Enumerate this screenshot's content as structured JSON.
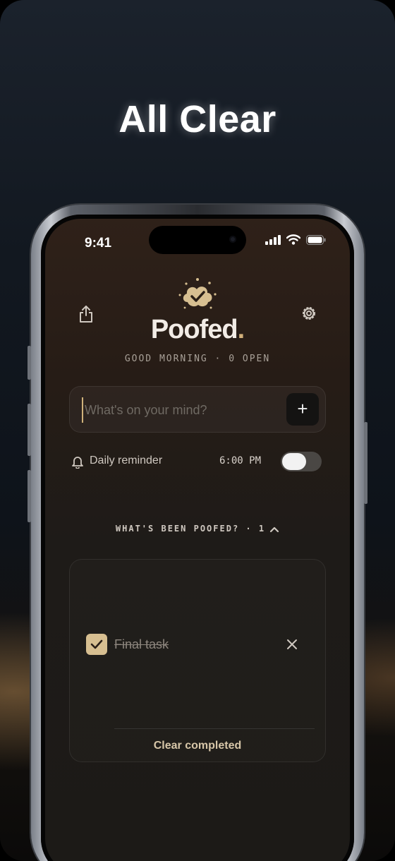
{
  "headline": "All Clear",
  "status_bar": {
    "time": "9:41"
  },
  "app": {
    "brand_name": "Poofed",
    "brand_dot": ".",
    "greeting": "GOOD MORNING · 0 OPEN",
    "input": {
      "value": "",
      "placeholder": "What's on your mind?"
    },
    "add_button_label": "+",
    "reminder": {
      "label": "Daily reminder",
      "time": "6:00 PM",
      "enabled": false
    },
    "completed_section": {
      "title": "WHAT'S BEEN POOFED? · 1",
      "items": [
        {
          "text": "Final task",
          "checked": true
        }
      ],
      "clear_label": "Clear completed"
    },
    "icons": {
      "share": "share-icon",
      "settings": "gear-icon",
      "bell": "bell-icon",
      "logo": "poof-cloud-check-icon",
      "chevron": "chevron-up-icon",
      "close": "close-icon"
    }
  },
  "colors": {
    "accent": "#d7bf91",
    "background": "#1e1b18",
    "brand_dot": "#d1b07a"
  }
}
